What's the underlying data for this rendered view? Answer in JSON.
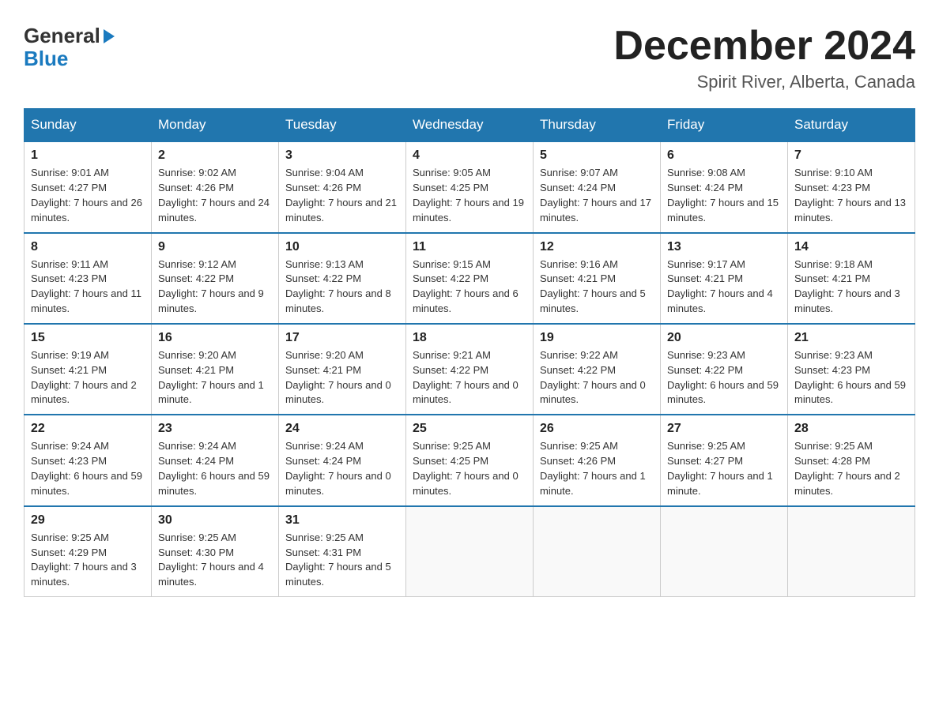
{
  "logo": {
    "line1_black": "General",
    "line1_arrow": "▶",
    "line2_blue": "Blue"
  },
  "title": {
    "month_year": "December 2024",
    "location": "Spirit River, Alberta, Canada"
  },
  "weekdays": [
    "Sunday",
    "Monday",
    "Tuesday",
    "Wednesday",
    "Thursday",
    "Friday",
    "Saturday"
  ],
  "weeks": [
    [
      {
        "day": "1",
        "sunrise": "9:01 AM",
        "sunset": "4:27 PM",
        "daylight": "7 hours and 26 minutes."
      },
      {
        "day": "2",
        "sunrise": "9:02 AM",
        "sunset": "4:26 PM",
        "daylight": "7 hours and 24 minutes."
      },
      {
        "day": "3",
        "sunrise": "9:04 AM",
        "sunset": "4:26 PM",
        "daylight": "7 hours and 21 minutes."
      },
      {
        "day": "4",
        "sunrise": "9:05 AM",
        "sunset": "4:25 PM",
        "daylight": "7 hours and 19 minutes."
      },
      {
        "day": "5",
        "sunrise": "9:07 AM",
        "sunset": "4:24 PM",
        "daylight": "7 hours and 17 minutes."
      },
      {
        "day": "6",
        "sunrise": "9:08 AM",
        "sunset": "4:24 PM",
        "daylight": "7 hours and 15 minutes."
      },
      {
        "day": "7",
        "sunrise": "9:10 AM",
        "sunset": "4:23 PM",
        "daylight": "7 hours and 13 minutes."
      }
    ],
    [
      {
        "day": "8",
        "sunrise": "9:11 AM",
        "sunset": "4:23 PM",
        "daylight": "7 hours and 11 minutes."
      },
      {
        "day": "9",
        "sunrise": "9:12 AM",
        "sunset": "4:22 PM",
        "daylight": "7 hours and 9 minutes."
      },
      {
        "day": "10",
        "sunrise": "9:13 AM",
        "sunset": "4:22 PM",
        "daylight": "7 hours and 8 minutes."
      },
      {
        "day": "11",
        "sunrise": "9:15 AM",
        "sunset": "4:22 PM",
        "daylight": "7 hours and 6 minutes."
      },
      {
        "day": "12",
        "sunrise": "9:16 AM",
        "sunset": "4:21 PM",
        "daylight": "7 hours and 5 minutes."
      },
      {
        "day": "13",
        "sunrise": "9:17 AM",
        "sunset": "4:21 PM",
        "daylight": "7 hours and 4 minutes."
      },
      {
        "day": "14",
        "sunrise": "9:18 AM",
        "sunset": "4:21 PM",
        "daylight": "7 hours and 3 minutes."
      }
    ],
    [
      {
        "day": "15",
        "sunrise": "9:19 AM",
        "sunset": "4:21 PM",
        "daylight": "7 hours and 2 minutes."
      },
      {
        "day": "16",
        "sunrise": "9:20 AM",
        "sunset": "4:21 PM",
        "daylight": "7 hours and 1 minute."
      },
      {
        "day": "17",
        "sunrise": "9:20 AM",
        "sunset": "4:21 PM",
        "daylight": "7 hours and 0 minutes."
      },
      {
        "day": "18",
        "sunrise": "9:21 AM",
        "sunset": "4:22 PM",
        "daylight": "7 hours and 0 minutes."
      },
      {
        "day": "19",
        "sunrise": "9:22 AM",
        "sunset": "4:22 PM",
        "daylight": "7 hours and 0 minutes."
      },
      {
        "day": "20",
        "sunrise": "9:23 AM",
        "sunset": "4:22 PM",
        "daylight": "6 hours and 59 minutes."
      },
      {
        "day": "21",
        "sunrise": "9:23 AM",
        "sunset": "4:23 PM",
        "daylight": "6 hours and 59 minutes."
      }
    ],
    [
      {
        "day": "22",
        "sunrise": "9:24 AM",
        "sunset": "4:23 PM",
        "daylight": "6 hours and 59 minutes."
      },
      {
        "day": "23",
        "sunrise": "9:24 AM",
        "sunset": "4:24 PM",
        "daylight": "6 hours and 59 minutes."
      },
      {
        "day": "24",
        "sunrise": "9:24 AM",
        "sunset": "4:24 PM",
        "daylight": "7 hours and 0 minutes."
      },
      {
        "day": "25",
        "sunrise": "9:25 AM",
        "sunset": "4:25 PM",
        "daylight": "7 hours and 0 minutes."
      },
      {
        "day": "26",
        "sunrise": "9:25 AM",
        "sunset": "4:26 PM",
        "daylight": "7 hours and 1 minute."
      },
      {
        "day": "27",
        "sunrise": "9:25 AM",
        "sunset": "4:27 PM",
        "daylight": "7 hours and 1 minute."
      },
      {
        "day": "28",
        "sunrise": "9:25 AM",
        "sunset": "4:28 PM",
        "daylight": "7 hours and 2 minutes."
      }
    ],
    [
      {
        "day": "29",
        "sunrise": "9:25 AM",
        "sunset": "4:29 PM",
        "daylight": "7 hours and 3 minutes."
      },
      {
        "day": "30",
        "sunrise": "9:25 AM",
        "sunset": "4:30 PM",
        "daylight": "7 hours and 4 minutes."
      },
      {
        "day": "31",
        "sunrise": "9:25 AM",
        "sunset": "4:31 PM",
        "daylight": "7 hours and 5 minutes."
      },
      null,
      null,
      null,
      null
    ]
  ]
}
